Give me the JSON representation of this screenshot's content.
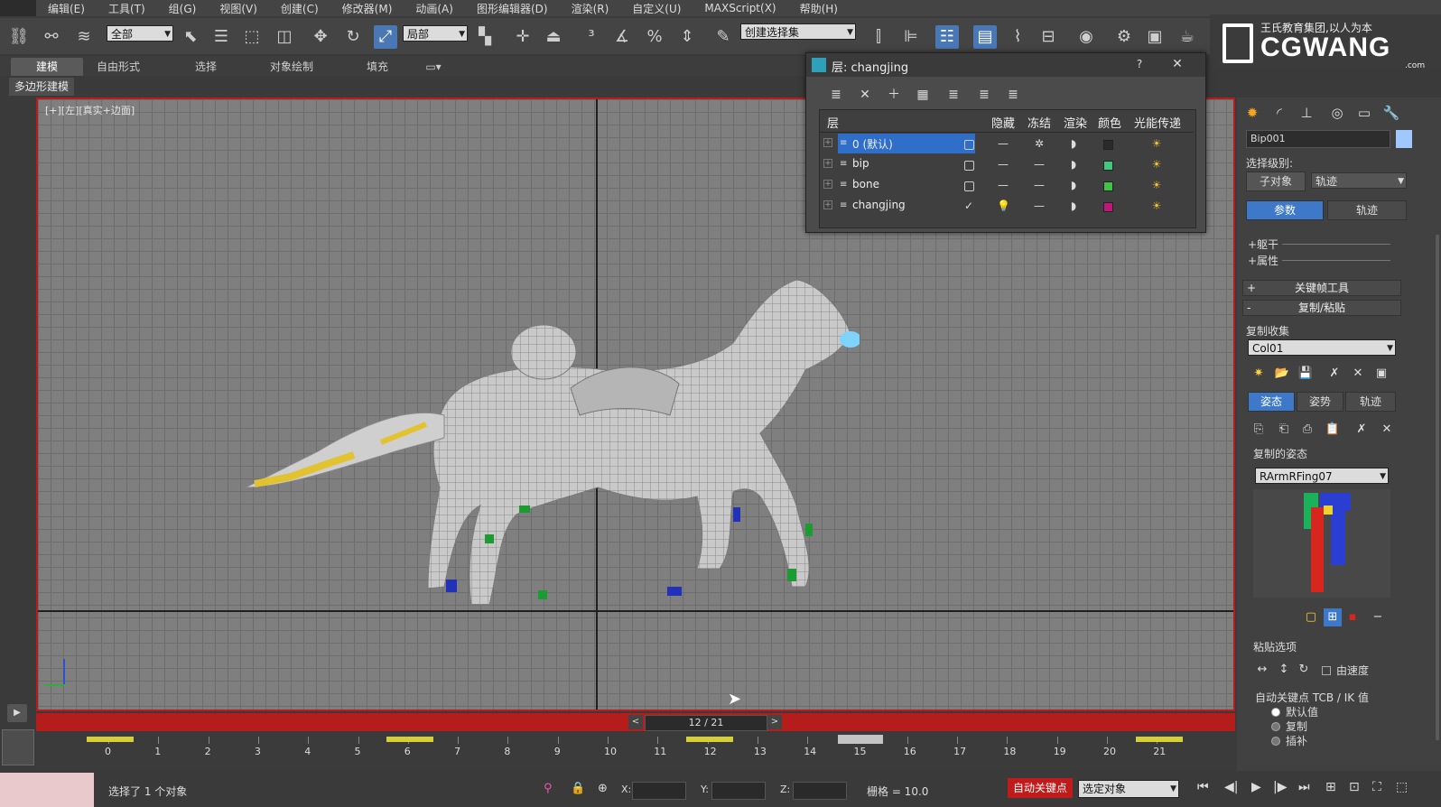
{
  "menu": [
    "编辑(E)",
    "工具(T)",
    "组(G)",
    "视图(V)",
    "创建(C)",
    "修改器(M)",
    "动画(A)",
    "图形编辑器(D)",
    "渲染(R)",
    "自定义(U)",
    "MAXScript(X)",
    "帮助(H)"
  ],
  "toolbar": {
    "filter_value": "全部",
    "coord_value": "局部",
    "selection_set_value": "创建选择集"
  },
  "brand": {
    "slogan": "王氏教育集团,以人为本",
    "name": "CGWANG",
    "domain": ".com"
  },
  "ribbon": {
    "tabs": [
      "建模",
      "自由形式",
      "选择",
      "对象绘制",
      "填充"
    ],
    "sub_label": "多边形建模"
  },
  "viewport": {
    "label": "[+][左][真实+边面]"
  },
  "layer_dialog": {
    "title": "层: changjing",
    "help": "?",
    "close": "✕",
    "headers": {
      "layer": "层",
      "hide": "隐藏",
      "freeze": "冻结",
      "render": "渲染",
      "color": "颜色",
      "radiosity": "光能传递"
    },
    "rows": [
      {
        "name": "0 (默认)",
        "color": "#2b2b2b",
        "current": false
      },
      {
        "name": "bip",
        "color": "#44c67c",
        "current": false
      },
      {
        "name": "bone",
        "color": "#43c24a",
        "current": false
      },
      {
        "name": "changjing",
        "color": "#c0177a",
        "current": true
      }
    ]
  },
  "time": {
    "slider_label": "12 / 21",
    "ticks": [
      "0",
      "1",
      "2",
      "3",
      "4",
      "5",
      "6",
      "7",
      "8",
      "9",
      "10",
      "11",
      "12",
      "13",
      "14",
      "15",
      "16",
      "17",
      "18",
      "19",
      "20",
      "21"
    ],
    "current_frame": 12
  },
  "status": {
    "message": "选择了 1 个对象",
    "x_label": "X:",
    "y_label": "Y:",
    "z_label": "Z:",
    "grid": "栅格 = 10.0",
    "auto_key": "自动关键点",
    "key_filter": "选定对象"
  },
  "command_panel": {
    "object_name": "Bip001",
    "selection_level_label": "选择级别:",
    "sub_object": "子对象",
    "track_dropdown": "轨迹",
    "tab_params": "参数",
    "tab_track": "轨迹",
    "collapsed_rolls": [
      "+躯干",
      "+属性"
    ],
    "rollout_keyframe": "关键帧工具",
    "rollout_copy": "复制/粘贴",
    "plus": "+",
    "minus": "-",
    "copy_collection_label": "复制收集",
    "copy_collection_value": "Col01",
    "mode_tabs": [
      "姿态",
      "姿势",
      "轨迹"
    ],
    "copied_pose_label": "复制的姿态",
    "copied_pose_value": "RArmRFing07",
    "paste_options_label": "粘贴选项",
    "by_velocity": "由速度",
    "auto_key_label": "自动关键点 TCB / IK 值",
    "radio_default": "默认值",
    "radio_copy": "复制",
    "radio_interp": "插补"
  },
  "colors": {
    "accent_blue": "#3d78c9",
    "frame_red": "#b51c1c",
    "key_yellow": "#d4cf3a"
  }
}
